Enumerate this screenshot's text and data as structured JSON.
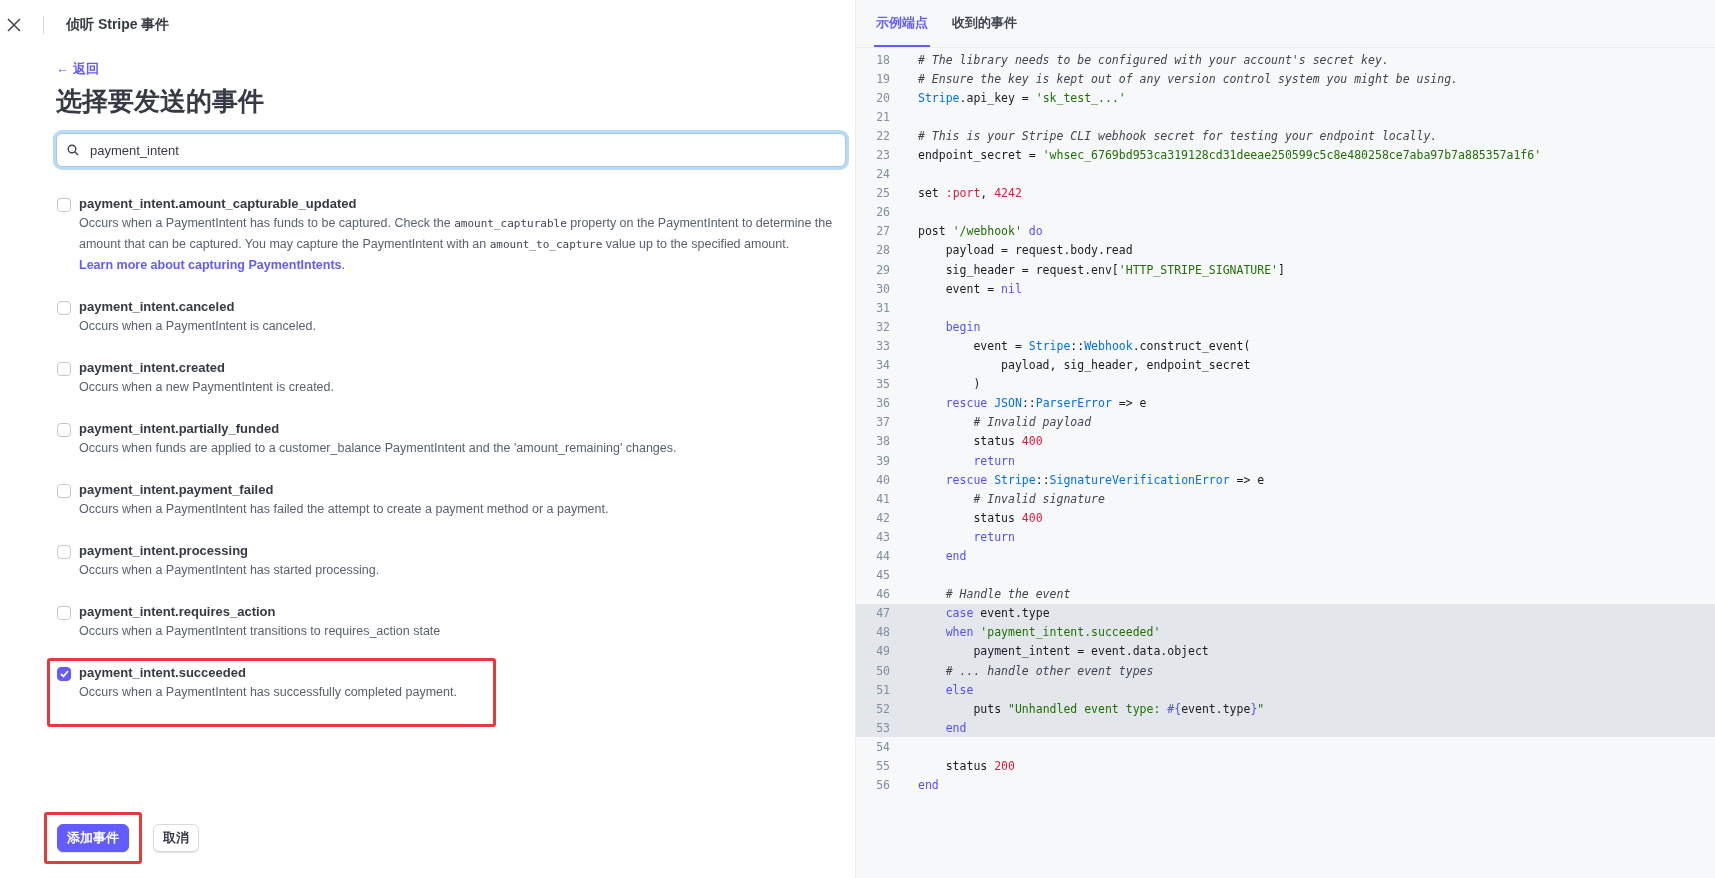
{
  "header": {
    "title": "侦听 Stripe 事件"
  },
  "back_link": "← 返回",
  "heading": "选择要发送的事件",
  "search": {
    "value": "payment_intent"
  },
  "events": [
    {
      "name": "payment_intent.amount_capturable_updated",
      "checked": false,
      "highlighted": false,
      "description": [
        {
          "kind": "text",
          "text": "Occurs when a PaymentIntent has funds to be captured. Check the "
        },
        {
          "kind": "code",
          "text": "amount_capturable"
        },
        {
          "kind": "text",
          "text": " property on the PaymentIntent to determine the amount that can be captured. You may capture the PaymentIntent with an "
        },
        {
          "kind": "code",
          "text": "amount_to_capture"
        },
        {
          "kind": "text",
          "text": " value up to the specified amount. "
        },
        {
          "kind": "link",
          "text": "Learn more about capturing PaymentIntents"
        },
        {
          "kind": "text",
          "text": "."
        }
      ]
    },
    {
      "name": "payment_intent.canceled",
      "checked": false,
      "highlighted": false,
      "description": [
        {
          "kind": "text",
          "text": "Occurs when a PaymentIntent is canceled."
        }
      ]
    },
    {
      "name": "payment_intent.created",
      "checked": false,
      "highlighted": false,
      "description": [
        {
          "kind": "text",
          "text": "Occurs when a new PaymentIntent is created."
        }
      ]
    },
    {
      "name": "payment_intent.partially_funded",
      "checked": false,
      "highlighted": false,
      "description": [
        {
          "kind": "text",
          "text": "Occurs when funds are applied to a customer_balance PaymentIntent and the 'amount_remaining' changes."
        }
      ]
    },
    {
      "name": "payment_intent.payment_failed",
      "checked": false,
      "highlighted": false,
      "description": [
        {
          "kind": "text",
          "text": "Occurs when a PaymentIntent has failed the attempt to create a payment method or a payment."
        }
      ]
    },
    {
      "name": "payment_intent.processing",
      "checked": false,
      "highlighted": false,
      "description": [
        {
          "kind": "text",
          "text": "Occurs when a PaymentIntent has started processing."
        }
      ]
    },
    {
      "name": "payment_intent.requires_action",
      "checked": false,
      "highlighted": false,
      "description": [
        {
          "kind": "text",
          "text": "Occurs when a PaymentIntent transitions to requires_action state"
        }
      ]
    },
    {
      "name": "payment_intent.succeeded",
      "checked": true,
      "highlighted": true,
      "description": [
        {
          "kind": "text",
          "text": "Occurs when a PaymentIntent has successfully completed payment."
        }
      ]
    }
  ],
  "buttons": [
    {
      "label": "添加事件",
      "kind": "primary",
      "highlighted": true
    },
    {
      "label": "取消",
      "kind": "secondary",
      "highlighted": false
    }
  ],
  "tabs": [
    {
      "label": "示例端点",
      "selected": true
    },
    {
      "label": "收到的事件",
      "selected": false
    }
  ],
  "code": [
    {
      "n": "18",
      "highlighted": false,
      "parts": [
        {
          "kind": "comment",
          "text": "# The library needs to be configured with your account's secret key."
        }
      ]
    },
    {
      "n": "19",
      "highlighted": false,
      "parts": [
        {
          "kind": "comment",
          "text": "# Ensure the key is kept out of any version control system you might be using."
        }
      ]
    },
    {
      "n": "20",
      "highlighted": false,
      "parts": [
        {
          "kind": "const",
          "text": "Stripe"
        },
        {
          "kind": "plain",
          "text": ".api_key = "
        },
        {
          "kind": "string",
          "text": "'sk_test_...'"
        }
      ]
    },
    {
      "n": "21",
      "highlighted": false
    },
    {
      "n": "22",
      "highlighted": false,
      "parts": [
        {
          "kind": "comment",
          "text": "# This is your Stripe CLI webhook secret for testing your endpoint locally."
        }
      ]
    },
    {
      "n": "23",
      "highlighted": false,
      "parts": [
        {
          "kind": "plain",
          "text": "endpoint_secret = "
        },
        {
          "kind": "string",
          "text": "'whsec_6769bd953ca319128cd31deeae250599c5c8e480258ce7aba97b7a885357a1f6'"
        }
      ]
    },
    {
      "n": "24",
      "highlighted": false
    },
    {
      "n": "25",
      "highlighted": false,
      "parts": [
        {
          "kind": "plain",
          "text": "set "
        },
        {
          "kind": "number",
          "text": ":port"
        },
        {
          "kind": "plain",
          "text": ", "
        },
        {
          "kind": "number",
          "text": "4242"
        }
      ]
    },
    {
      "n": "26",
      "highlighted": false
    },
    {
      "n": "27",
      "highlighted": false,
      "parts": [
        {
          "kind": "plain",
          "text": "post "
        },
        {
          "kind": "string",
          "text": "'/webhook'"
        },
        {
          "kind": "keyword",
          "text": " do"
        }
      ]
    },
    {
      "n": "28",
      "highlighted": false,
      "parts": [
        {
          "kind": "plain",
          "text": "    payload = request.body.read"
        }
      ]
    },
    {
      "n": "29",
      "highlighted": false,
      "parts": [
        {
          "kind": "plain",
          "text": "    sig_header = request.env["
        },
        {
          "kind": "string",
          "text": "'HTTP_STRIPE_SIGNATURE'"
        },
        {
          "kind": "plain",
          "text": "]"
        }
      ]
    },
    {
      "n": "30",
      "highlighted": false,
      "parts": [
        {
          "kind": "plain",
          "text": "    event = "
        },
        {
          "kind": "keyword",
          "text": "nil"
        }
      ]
    },
    {
      "n": "31",
      "highlighted": false
    },
    {
      "n": "32",
      "highlighted": false,
      "parts": [
        {
          "kind": "keyword",
          "text": "    begin"
        }
      ]
    },
    {
      "n": "33",
      "highlighted": false,
      "parts": [
        {
          "kind": "plain",
          "text": "        event = "
        },
        {
          "kind": "const",
          "text": "Stripe"
        },
        {
          "kind": "plain",
          "text": "::"
        },
        {
          "kind": "const",
          "text": "Webhook"
        },
        {
          "kind": "plain",
          "text": ".construct_event("
        }
      ]
    },
    {
      "n": "34",
      "highlighted": false,
      "parts": [
        {
          "kind": "plain",
          "text": "            payload, sig_header, endpoint_secret"
        }
      ]
    },
    {
      "n": "35",
      "highlighted": false,
      "parts": [
        {
          "kind": "plain",
          "text": "        )"
        }
      ]
    },
    {
      "n": "36",
      "highlighted": false,
      "parts": [
        {
          "kind": "keyword",
          "text": "    rescue "
        },
        {
          "kind": "const",
          "text": "JSON"
        },
        {
          "kind": "plain",
          "text": "::"
        },
        {
          "kind": "const",
          "text": "ParserError"
        },
        {
          "kind": "plain",
          "text": " => e"
        }
      ]
    },
    {
      "n": "37",
      "highlighted": false,
      "parts": [
        {
          "kind": "comment",
          "text": "        # Invalid payload"
        }
      ]
    },
    {
      "n": "38",
      "highlighted": false,
      "parts": [
        {
          "kind": "plain",
          "text": "        status "
        },
        {
          "kind": "number",
          "text": "400"
        }
      ]
    },
    {
      "n": "39",
      "highlighted": false,
      "parts": [
        {
          "kind": "keyword",
          "text": "        return"
        }
      ]
    },
    {
      "n": "40",
      "highlighted": false,
      "parts": [
        {
          "kind": "keyword",
          "text": "    rescue "
        },
        {
          "kind": "const",
          "text": "Stripe"
        },
        {
          "kind": "plain",
          "text": "::"
        },
        {
          "kind": "const",
          "text": "SignatureVerificationError"
        },
        {
          "kind": "plain",
          "text": " => e"
        }
      ]
    },
    {
      "n": "41",
      "highlighted": false,
      "parts": [
        {
          "kind": "comment",
          "text": "        # Invalid signature"
        }
      ]
    },
    {
      "n": "42",
      "highlighted": false,
      "parts": [
        {
          "kind": "plain",
          "text": "        status "
        },
        {
          "kind": "number",
          "text": "400"
        }
      ]
    },
    {
      "n": "43",
      "highlighted": false,
      "parts": [
        {
          "kind": "keyword",
          "text": "        return"
        }
      ]
    },
    {
      "n": "44",
      "highlighted": false,
      "parts": [
        {
          "kind": "keyword",
          "text": "    end"
        }
      ]
    },
    {
      "n": "45",
      "highlighted": false
    },
    {
      "n": "46",
      "highlighted": false,
      "parts": [
        {
          "kind": "comment",
          "text": "    # Handle the event"
        }
      ]
    },
    {
      "n": "47",
      "highlighted": true,
      "parts": [
        {
          "kind": "keyword",
          "text": "    case"
        },
        {
          "kind": "plain",
          "text": " event.type"
        }
      ]
    },
    {
      "n": "48",
      "highlighted": true,
      "parts": [
        {
          "kind": "keyword",
          "text": "    when "
        },
        {
          "kind": "string",
          "text": "'payment_intent.succeeded'"
        }
      ]
    },
    {
      "n": "49",
      "highlighted": true,
      "parts": [
        {
          "kind": "plain",
          "text": "        payment_intent = event.data.object"
        }
      ]
    },
    {
      "n": "50",
      "highlighted": true,
      "parts": [
        {
          "kind": "comment",
          "text": "    # ... handle other event types"
        }
      ]
    },
    {
      "n": "51",
      "highlighted": true,
      "parts": [
        {
          "kind": "keyword",
          "text": "    else"
        }
      ]
    },
    {
      "n": "52",
      "highlighted": true,
      "parts": [
        {
          "kind": "plain",
          "text": "        puts "
        },
        {
          "kind": "string",
          "text": "\"Unhandled event type: "
        },
        {
          "kind": "keyword",
          "text": "#{"
        },
        {
          "kind": "plain",
          "text": "event.type"
        },
        {
          "kind": "keyword",
          "text": "}"
        },
        {
          "kind": "string",
          "text": "\""
        }
      ]
    },
    {
      "n": "53",
      "highlighted": true,
      "parts": [
        {
          "kind": "keyword",
          "text": "    end"
        }
      ]
    },
    {
      "n": "54",
      "highlighted": false
    },
    {
      "n": "55",
      "highlighted": false,
      "parts": [
        {
          "kind": "plain",
          "text": "    status "
        },
        {
          "kind": "number",
          "text": "200"
        }
      ]
    },
    {
      "n": "56",
      "highlighted": false,
      "parts": [
        {
          "kind": "keyword",
          "text": "end"
        }
      ]
    }
  ]
}
